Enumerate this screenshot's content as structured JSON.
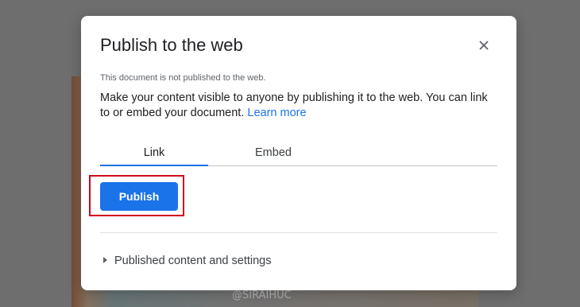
{
  "dialog": {
    "title": "Publish to the web",
    "status": "This document is not published to the web.",
    "description": "Make your content visible to anyone by publishing it to the web. You can link to or embed your document.",
    "learn_more": "Learn more",
    "tabs": [
      {
        "label": "Link",
        "active": true
      },
      {
        "label": "Embed",
        "active": false
      }
    ],
    "publish_label": "Publish",
    "settings_label": "Published content and settings"
  },
  "watermark": "@SIRAIHUC",
  "colors": {
    "accent": "#1a73e8",
    "highlight": "#d0021b"
  },
  "icons": {
    "close": "close-icon",
    "caret": "caret-right-icon"
  }
}
